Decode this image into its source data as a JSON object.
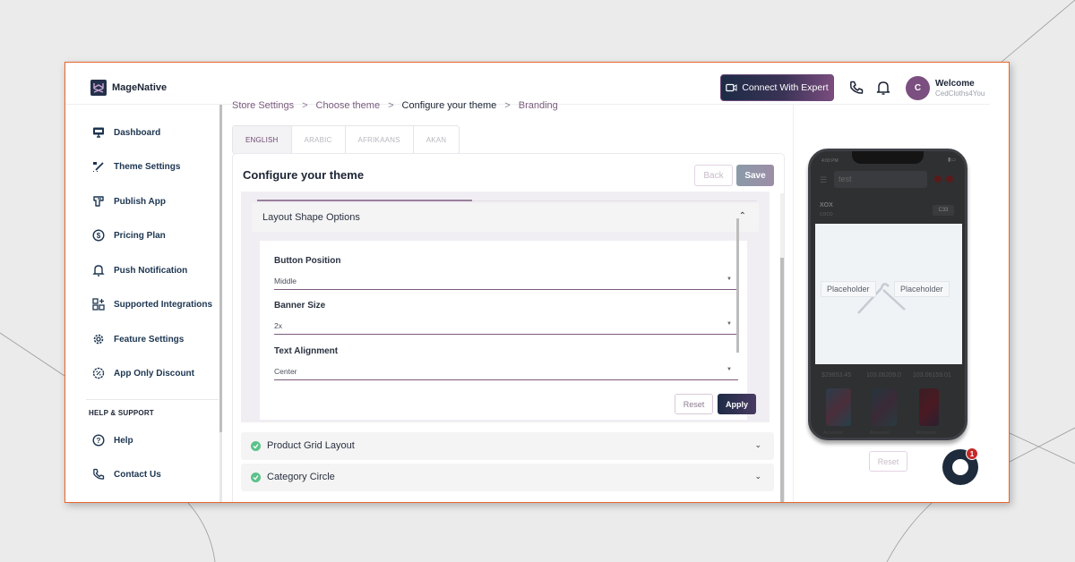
{
  "app": {
    "brand": "MageNative",
    "brand_logo_letters": "MN"
  },
  "header": {
    "connect_button": "Connect With Expert",
    "connect_icon": "video-camera-icon",
    "phone_icon": "phone-icon",
    "bell_icon": "bell-icon",
    "avatar_initial": "C",
    "welcome_label": "Welcome",
    "store_name": "CedCloths4You"
  },
  "sidebar": {
    "items": [
      {
        "label": "Dashboard",
        "icon": "monitor-icon"
      },
      {
        "label": "Theme Settings",
        "icon": "paint-brush-icon"
      },
      {
        "label": "Publish App",
        "icon": "publish-icon"
      },
      {
        "label": "Pricing Plan",
        "icon": "dollar-circle-icon"
      },
      {
        "label": "Push Notification",
        "icon": "bell-icon"
      },
      {
        "label": "Supported Integrations",
        "icon": "grid-plus-icon"
      },
      {
        "label": "Feature Settings",
        "icon": "gear-icon"
      },
      {
        "label": "App Only Discount",
        "icon": "discount-badge-icon"
      }
    ],
    "section_title": "HELP & SUPPORT",
    "support_items": [
      {
        "label": "Help",
        "icon": "question-circle-icon"
      },
      {
        "label": "Contact Us",
        "icon": "phone-icon"
      }
    ]
  },
  "breadcrumb": {
    "items": [
      "Store Settings",
      "Choose theme",
      "Configure your theme",
      "Branding"
    ],
    "current_index": 2,
    "separator": ">"
  },
  "language_tabs": {
    "tabs": [
      "ENGLISH",
      "ARABIC",
      "AFRIKAANS",
      "AKAN"
    ],
    "active": "ENGLISH"
  },
  "configure": {
    "title": "Configure your theme",
    "back_label": "Back",
    "save_label": "Save",
    "section_progress_fraction": 0.43,
    "expanded_section": {
      "title": "Layout Shape Options",
      "fields": [
        {
          "label": "Button Position",
          "value": "Middle"
        },
        {
          "label": "Banner Size",
          "value": "2x"
        },
        {
          "label": "Text Alignment",
          "value": "Center"
        }
      ],
      "reset_label": "Reset",
      "apply_label": "Apply"
    },
    "collapsed_sections": [
      {
        "title": "Product Grid Layout",
        "status": "complete"
      },
      {
        "title": "Category Circle",
        "status": "complete"
      }
    ]
  },
  "preview": {
    "status_time": "4:00 PM",
    "search_text": "test",
    "header_title": "XOX",
    "header_subtitle": "coco",
    "header_badge": "C33",
    "banner_placeholders": [
      "Placeholder",
      "Placeholder"
    ],
    "prices": [
      "$29853.45",
      "103.06209.0",
      "103.06159.01"
    ],
    "product_labels": [
      "Accessori",
      "Accessori",
      "Accessori"
    ],
    "reset_label": "Reset"
  },
  "chat": {
    "badge_count": "1"
  },
  "colors": {
    "frame_border": "#e8652a",
    "primary_dark": "#1d2b46",
    "accent_purple": "#7b4f7f",
    "success_green": "#5cc28a",
    "badge_red": "#c62828"
  }
}
